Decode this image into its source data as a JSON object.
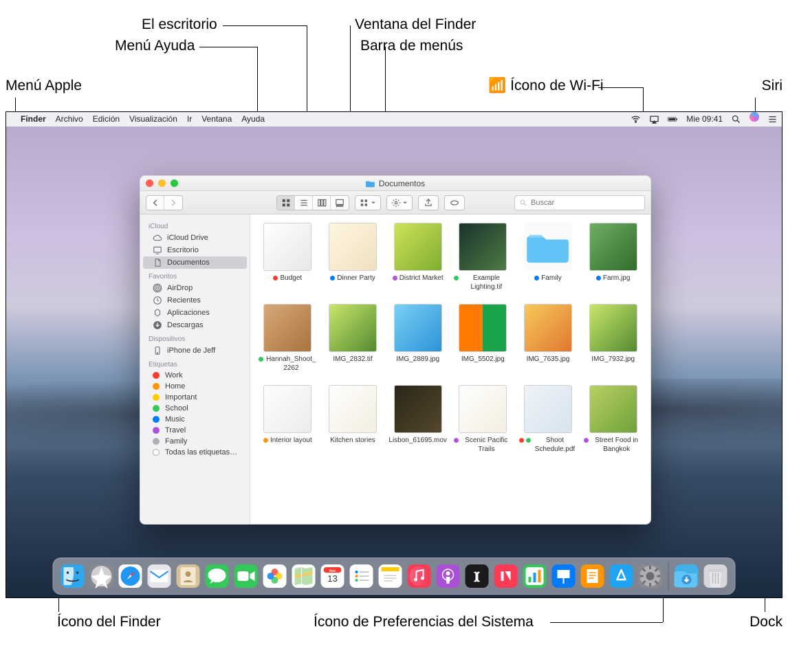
{
  "callouts": {
    "apple_menu": "Menú Apple",
    "help_menu": "Menú Ayuda",
    "desktop": "El escritorio",
    "finder_window": "Ventana del Finder",
    "menubar": "Barra de menús",
    "wifi_icon": "Ícono de Wi-Fi",
    "siri": "Siri",
    "finder_icon": "Ícono del Finder",
    "sysprefs_icon": "Ícono de Preferencias del Sistema",
    "dock": "Dock"
  },
  "menubar": {
    "app": "Finder",
    "items": [
      "Archivo",
      "Edición",
      "Visualización",
      "Ir",
      "Ventana",
      "Ayuda"
    ],
    "clock": "Mie 09:41"
  },
  "finder": {
    "title": "Documentos",
    "search_placeholder": "Buscar",
    "sidebar": {
      "sections": [
        {
          "head": "iCloud",
          "items": [
            {
              "label": "iCloud Drive",
              "icon": "cloud"
            },
            {
              "label": "Escritorio",
              "icon": "desktop"
            },
            {
              "label": "Documentos",
              "icon": "doc",
              "active": true
            }
          ]
        },
        {
          "head": "Favoritos",
          "items": [
            {
              "label": "AirDrop",
              "icon": "airdrop"
            },
            {
              "label": "Recientes",
              "icon": "clock"
            },
            {
              "label": "Aplicaciones",
              "icon": "apps"
            },
            {
              "label": "Descargas",
              "icon": "download"
            }
          ]
        },
        {
          "head": "Dispositivos",
          "items": [
            {
              "label": "iPhone de Jeff",
              "icon": "phone"
            }
          ]
        },
        {
          "head": "Etiquetas",
          "tags": [
            {
              "label": "Work",
              "color": "c-red"
            },
            {
              "label": "Home",
              "color": "c-orange"
            },
            {
              "label": "Important",
              "color": "c-yellow"
            },
            {
              "label": "School",
              "color": "c-green"
            },
            {
              "label": "Music",
              "color": "c-blue"
            },
            {
              "label": "Travel",
              "color": "c-purple"
            },
            {
              "label": "Family",
              "color": "c-gray"
            },
            {
              "label": "Todas las etiquetas…",
              "color": ""
            }
          ]
        }
      ]
    },
    "files": [
      {
        "name": "Budget",
        "tags": [
          "c-red"
        ],
        "thumb": "g1"
      },
      {
        "name": "Dinner Party",
        "tags": [
          "c-blue"
        ],
        "thumb": "g2"
      },
      {
        "name": "District Market",
        "tags": [
          "c-purple"
        ],
        "thumb": "g3"
      },
      {
        "name": "Example Lighting.tif",
        "tags": [
          "c-green"
        ],
        "thumb": "g4"
      },
      {
        "name": "Family",
        "tags": [
          "c-blue"
        ],
        "thumb": "folder"
      },
      {
        "name": "Farm.jpg",
        "tags": [
          "c-blue"
        ],
        "thumb": "g5"
      },
      {
        "name": "Hannah_Shoot_2262",
        "tags": [
          "c-green"
        ],
        "thumb": "g6"
      },
      {
        "name": "IMG_2832.tif",
        "tags": [],
        "thumb": "g10"
      },
      {
        "name": "IMG_2889.jpg",
        "tags": [],
        "thumb": "g7"
      },
      {
        "name": "IMG_5502.jpg",
        "tags": [],
        "thumb": "g8"
      },
      {
        "name": "IMG_7635.jpg",
        "tags": [],
        "thumb": "g9"
      },
      {
        "name": "IMG_7932.jpg",
        "tags": [],
        "thumb": "g10"
      },
      {
        "name": "Interior layout",
        "tags": [
          "c-orange"
        ],
        "thumb": "g11"
      },
      {
        "name": "Kitchen stories",
        "tags": [],
        "thumb": "g13"
      },
      {
        "name": "Lisbon_61695.mov",
        "tags": [],
        "thumb": "g12"
      },
      {
        "name": "Scenic Pacific Trails",
        "tags": [
          "c-purple"
        ],
        "thumb": "g13"
      },
      {
        "name": "Shoot Schedule.pdf",
        "tags": [
          "c-red",
          "c-green"
        ],
        "thumb": "g14"
      },
      {
        "name": "Street Food in Bangkok",
        "tags": [
          "c-purple"
        ],
        "thumb": "g15"
      }
    ]
  },
  "dock": {
    "calendar_day": "13",
    "calendar_month": "Nov",
    "apps": [
      "finder",
      "launchpad",
      "safari",
      "mail",
      "contacts",
      "messages",
      "facetime",
      "photos",
      "maps",
      "calendar",
      "reminders",
      "notes",
      "music",
      "podcasts",
      "tv",
      "news",
      "numbers",
      "keynote",
      "pages",
      "appstore",
      "sysprefs"
    ],
    "right": [
      "downloads",
      "trash"
    ]
  }
}
